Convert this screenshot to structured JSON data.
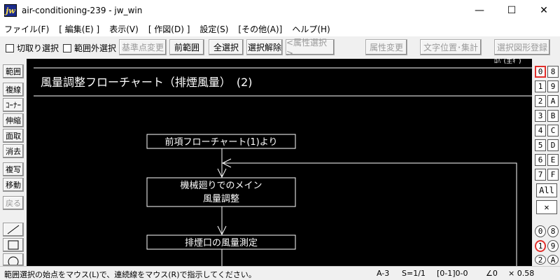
{
  "window": {
    "icon_text": "jw",
    "title": "air-conditioning-239 - jw_win",
    "minimize": "—",
    "maximize": "☐",
    "close": "✕"
  },
  "menu": [
    "ファイル(F)",
    "[ 編集(E) ]",
    "表示(V)",
    "[ 作図(D) ]",
    "設定(S)",
    "[その他(A)]",
    "ヘルプ(H)"
  ],
  "toolbar": {
    "crop_select": "切取り選択",
    "outside_select": "範囲外選択",
    "base_point_change": "基準点変更",
    "prev_range": "前範囲",
    "select_all": "全選択",
    "deselect": "選択解除",
    "attr_select": "<属性選択>",
    "attr_change": "属性変更",
    "text_pos_sum": "文字位置･集計",
    "register_shape": "選択図形登録"
  },
  "left_tools": [
    "範囲",
    "複線",
    "ｺｰﾅｰ",
    "伸縮",
    "面取",
    "消去",
    "複写",
    "移動",
    "戻る"
  ],
  "drawing": {
    "corner_fragment": "ﾛﾊﾟ(主ｷﾞ)",
    "heading": "風量調整フローチャート（排煙風量）　(2)",
    "box1": "前項フローチャート(1)より",
    "box2_line1": "機械廻りでのメイン",
    "box2_line2": "風量調整",
    "box3": "排煙口の風量測定"
  },
  "layers": {
    "grid": [
      [
        "0",
        "8"
      ],
      [
        "1",
        "9"
      ],
      [
        "2",
        "A"
      ],
      [
        "3",
        "B"
      ],
      [
        "4",
        "C"
      ],
      [
        "5",
        "D"
      ],
      [
        "6",
        "E"
      ],
      [
        "7",
        "F"
      ]
    ],
    "all": "All",
    "cross": "✕",
    "groups": [
      [
        "0",
        "8"
      ],
      [
        "1",
        "9"
      ],
      [
        "2",
        "A"
      ]
    ]
  },
  "status": {
    "message": "範囲選択の始点をマウス(L)で、連続線をマウス(R)で指示してください。",
    "paper": "A-3",
    "scale": "S=1/1",
    "layer": "[0-1]0-0",
    "angle": "∠0",
    "zoom": "× 0.58"
  }
}
